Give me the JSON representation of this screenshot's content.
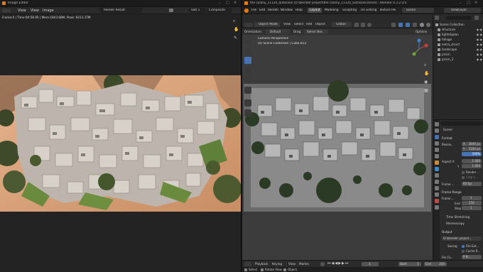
{
  "left": {
    "title": "Image Editor",
    "menu": [
      "View",
      "View",
      "Image"
    ],
    "image_name": "Render Result",
    "slot": "Slot 1",
    "layer": "Composite",
    "info": "Frame:0 | Time:00:58.95 | Mem:1843.68M, Peak: 6413.37M"
  },
  "right": {
    "title": "the colony_11124_autosave [D:\\blender project\\the colony_11124_autosave.blend] - Blender 4.3.2 LTS",
    "menus": [
      "File",
      "Edit",
      "Render",
      "Window",
      "Help"
    ],
    "workspaces": [
      "Layout",
      "Modeling",
      "Sculpting",
      "UV Editing",
      "Texture Pai"
    ],
    "active_workspace": "Layout",
    "scene": "Scene",
    "view_layer": "ViewLayer",
    "vp_header": {
      "mode": "Object Mode",
      "items": [
        "View",
        "Select",
        "Add",
        "Object"
      ],
      "transform": "Global"
    },
    "tool_header": {
      "orientation_label": "Orientation:",
      "orientation": "Default",
      "drag_label": "Drag:",
      "drag": "Select Box",
      "options": "Options"
    },
    "overlay": {
      "line1": "Camera Perspective",
      "line2": "(0) Scene Collection | Cube.053"
    },
    "outliner": {
      "header": "Scene Collection",
      "items": [
        "structure",
        "lights&plan",
        "foliage",
        "extra_struct",
        "landscape",
        "prism",
        "prism_2"
      ]
    },
    "properties": {
      "scene_label": "Scene",
      "format_label": "Format",
      "resolution_label": "Resolu...",
      "res_x_label": "X",
      "res_x": "3840 px",
      "res_y_label": "Y",
      "res_y": "2160 px",
      "res_pct": "100%",
      "aspect_label": "Aspect X",
      "aspect_x": "1.000",
      "aspect_y_label": "Y",
      "aspect_y": "1.000",
      "render_region": "Render ...",
      "crop": "Crop t...",
      "framerate_label": "Frame ...",
      "framerate": "60 fps",
      "frame_range_label": "Frame Range",
      "frame_start_label": "Frame ...",
      "frame_start": "1",
      "frame_end_label": "End",
      "frame_end": "250",
      "frame_step_label": "Step",
      "frame_step": "1",
      "time_stretching": "Time Stretching",
      "stereoscopy": "Stereoscopy",
      "output_label": "Output",
      "output_path": "D:\\blender project...",
      "saving_label": "Saving",
      "file_ext": "File Ext...",
      "cache_result": "Cache R...",
      "file_format_label": "File Fo...",
      "file_format": "P N..."
    },
    "timeline": {
      "items": [
        "Playback",
        "Keying",
        "View",
        "Marker"
      ],
      "current_frame": "1",
      "start_label": "Start",
      "start": "1",
      "end_label": "End",
      "end": "250"
    },
    "status": [
      "Select",
      "Rotate View",
      "Object"
    ]
  },
  "colors": {
    "accent_blue": "#4772b3",
    "active_tab": "#4772b3"
  }
}
